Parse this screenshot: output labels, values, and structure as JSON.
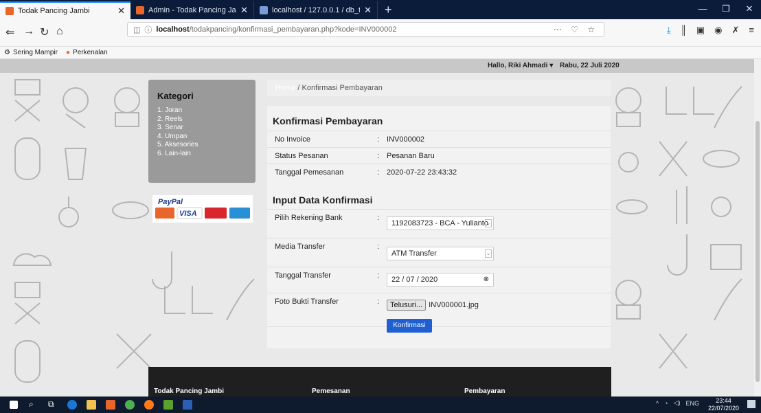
{
  "browser": {
    "tabs": [
      {
        "label": "Todak Pancing Jambi",
        "active": true
      },
      {
        "label": "Admin - Todak Pancing Jambi",
        "active": false
      },
      {
        "label": "localhost / 127.0.0.1 / db_todak",
        "active": false
      }
    ],
    "url_host": "localhost",
    "url_path": "/todakpancing/konfirmasi_pembayaran.php?kode=INV000002",
    "bookmarks": [
      "Sering Mampir",
      "Perkenalan"
    ]
  },
  "topbar": {
    "greeting": "Hallo, Riki Ahmadi ▾",
    "date": "Rabu, 22 Juli 2020"
  },
  "kategori": {
    "title": "Kategori",
    "items": [
      "1. Joran",
      "2. Reels",
      "3. Senar",
      "4. Umpan",
      "5. Aksesories",
      "6. Lain-lain"
    ]
  },
  "breadcrumb": {
    "home": "Home",
    "current": "/ Konfirmasi Pembayaran"
  },
  "konfirmasi": {
    "title": "Konfirmasi Pembayaran",
    "rows": [
      {
        "label": "No Invoice",
        "value": "INV000002"
      },
      {
        "label": "Status Pesanan",
        "value": "Pesanan Baru"
      },
      {
        "label": "Tanggal Pemesanan",
        "value": "2020-07-22 23:43:32"
      }
    ]
  },
  "input": {
    "title": "Input Data Konfirmasi",
    "rekening_label": "Pilih Rekening Bank",
    "rekening_value": "1192083723 - BCA - Yulianto",
    "media_label": "Media Transfer",
    "media_value": "ATM Transfer",
    "tanggal_label": "Tanggal Transfer",
    "tanggal_value": "22 / 07 / 2020",
    "foto_label": "Foto Bukti Transfer",
    "foto_button": "Telusuri...",
    "foto_file": "INV000001.jpg",
    "submit": "Konfirmasi",
    "separator": ":"
  },
  "footer": {
    "col1": "Todak Pancing Jambi",
    "col2": "Pemesanan",
    "col3": "Pembayaran"
  },
  "paypal": {
    "brand": "PayPal",
    "cards": [
      "Mastercard",
      "VISA",
      "Maestro",
      "Amex"
    ]
  },
  "taskbar": {
    "lang": "ENG",
    "time": "23:44",
    "date": "22/07/2020"
  }
}
